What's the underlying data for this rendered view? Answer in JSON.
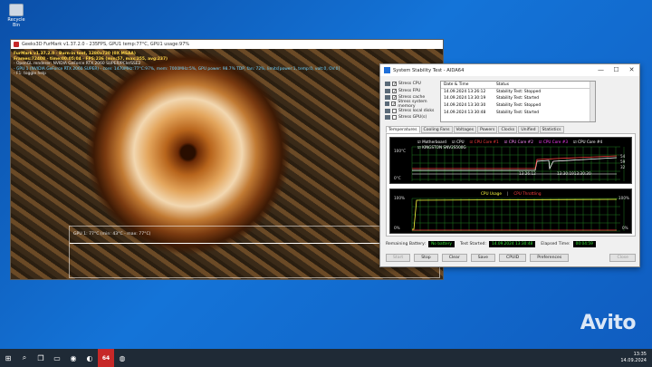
{
  "desktop": {
    "icon_label": "Recycle Bin"
  },
  "furmark": {
    "title": "Geeks3D FurMark v1.37.2.0 - 235FPS, GPU1 temp:77°C, GPU1 usage:97%",
    "overlay": [
      {
        "cls": "y",
        "text": "FurMark v1.37.2.0 - Burn-in test, 1280x720 (0X MSAA)"
      },
      {
        "cls": "y",
        "text": "Frames:72408 - time:00:05:04 - FPS:236 (min:57, max:255, avg:237)"
      },
      {
        "cls": "w",
        "text": "- OpenGL renderer: NVIDIA GeForce RTX 2060 SUPER/PCIe/SSE2"
      },
      {
        "cls": "c",
        "text": "- GPU 1 (NVIDIA GeForce RTX 2060 SUPER) - core: 1470MHz:77°C:97%, mem: 7000MHz:5%, GPU power: 98.7% TDP, fan: 72%, limits[power:1, temp:0, volt:0, OV:0]"
      },
      {
        "cls": "w",
        "text": "- F1: toggle help"
      }
    ],
    "graph_label": "GPU 1: 77°C (min: 43°C - max: 77°C)"
  },
  "aida": {
    "title": "System Stability Test - AIDA64",
    "window_controls": [
      "—",
      "☐",
      "✕"
    ],
    "stress": [
      {
        "label": "Stress CPU",
        "checked": true
      },
      {
        "label": "Stress FPU",
        "checked": true
      },
      {
        "label": "Stress cache",
        "checked": true
      },
      {
        "label": "Stress system memory",
        "checked": true
      },
      {
        "label": "Stress local disks",
        "checked": false
      },
      {
        "label": "Stress GPU(s)",
        "checked": false
      }
    ],
    "log": {
      "headers": [
        "Date & Time",
        "Status"
      ],
      "rows": [
        {
          "dt": "14.09.2024 13:26:12",
          "status": "Stability Test: Stopped"
        },
        {
          "dt": "14.09.2024 13:30:19",
          "status": "Stability Test: Started"
        },
        {
          "dt": "14.09.2024 13:30:30",
          "status": "Stability Test: Stopped"
        },
        {
          "dt": "14.09.2024 13:30:48",
          "status": "Stability Test: Started"
        }
      ]
    },
    "tabs": [
      "Temperatures",
      "Cooling Fans",
      "Voltages",
      "Powers",
      "Clocks",
      "Unified",
      "Statistics"
    ],
    "active_tab": "Temperatures",
    "temp_legend": [
      {
        "label": "Motherboard",
        "color": "#ffffff"
      },
      {
        "label": "CPU",
        "color": "#ffffff"
      },
      {
        "label": "CPU Core #1",
        "color": "#ff4040"
      },
      {
        "label": "CPU Core #2",
        "color": "#ff8cff"
      },
      {
        "label": "CPU Core #3",
        "color": "#ff40ff"
      },
      {
        "label": "CPU Core #4",
        "color": "#ffffff"
      },
      {
        "label": "KINGSTON SNV2S500G",
        "color": "#ffffff"
      }
    ],
    "temp_axis": {
      "top": "100°C",
      "bottom": "0°C"
    },
    "temp_times": [
      "13:26:12",
      "13:30:1913:30:30"
    ],
    "temp_right": [
      "54",
      "59",
      "32"
    ],
    "usage_legend": {
      "cpu": "CPU Usage",
      "sep": "|",
      "throttle": "CPU Throttling"
    },
    "usage_axis": {
      "top": "100%",
      "bottom": "0%",
      "right_top": "100%",
      "right_bottom": "0%"
    },
    "status": {
      "battery_label": "Remaining Battery:",
      "battery_value": "No battery",
      "started_label": "Test Started:",
      "started_value": "14.09.2024 13:30:48",
      "elapsed_label": "Elapsed Time:",
      "elapsed_value": "00:04:59"
    },
    "buttons": {
      "start": "Start",
      "stop": "Stop",
      "clear": "Clear",
      "save": "Save",
      "cpuid": "CPUID",
      "prefs": "Preferences",
      "close": "Close"
    }
  },
  "taskbar": {
    "icons": [
      "windows-start",
      "search",
      "task-view",
      "file-explorer",
      "chrome",
      "edge",
      "aida64",
      "furmark"
    ],
    "icon_glyphs": [
      "⊞",
      "⌕",
      "❐",
      "▭",
      "◉",
      "◐",
      "64",
      "◍"
    ],
    "time": "13:35",
    "date": "14.09.2024"
  },
  "watermark": "Avito"
}
